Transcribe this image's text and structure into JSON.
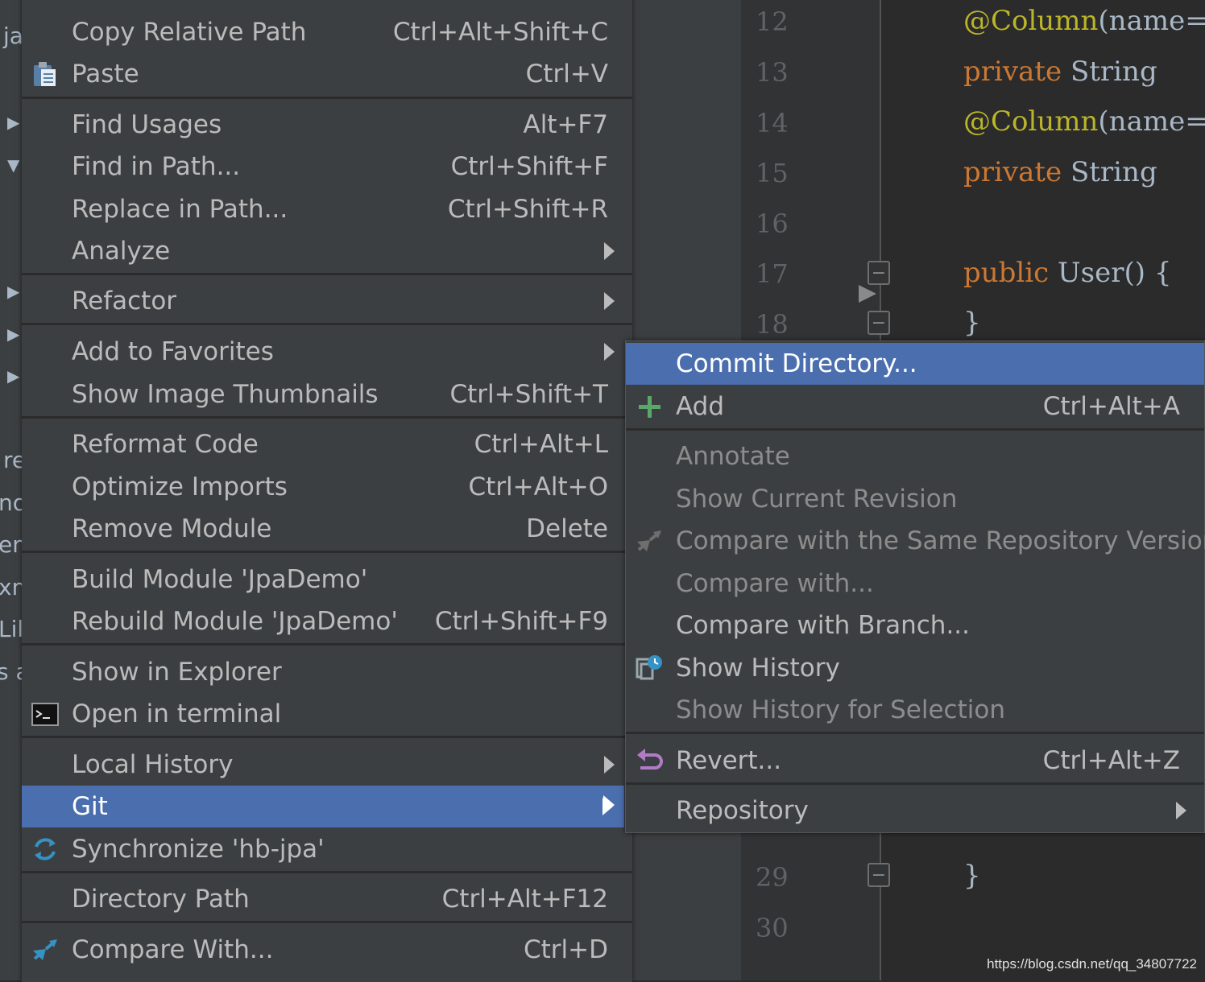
{
  "project": {
    "fragments": [
      "ja",
      "re",
      "no",
      "em",
      "xm",
      "Lil",
      "s a"
    ]
  },
  "editor": {
    "line_numbers": [
      "12",
      "13",
      "14",
      "15",
      "16",
      "17",
      "18",
      "29",
      "30"
    ],
    "code": {
      "l12_ann": "@Column",
      "l12_rest": "(name=\"u",
      "l13_kw": "private",
      "l13_rest": " String",
      "l14_ann": "@Column",
      "l14_rest": "(name=\"p",
      "l15_kw": "private",
      "l15_rest": " String",
      "l17_kw": "public",
      "l17_rest": " User() {",
      "l18": "}",
      "l29": "}"
    },
    "watermark": "https://blog.csdn.net/qq_34807722"
  },
  "context_menu": {
    "items": [
      {
        "label": "Copy Relative Path",
        "shortcut": "Ctrl+Alt+Shift+C"
      },
      {
        "label": "Paste",
        "shortcut": "Ctrl+V"
      },
      {
        "label": "Find Usages",
        "shortcut": "Alt+F7"
      },
      {
        "label": "Find in Path...",
        "shortcut": "Ctrl+Shift+F"
      },
      {
        "label": "Replace in Path...",
        "shortcut": "Ctrl+Shift+R"
      },
      {
        "label": "Analyze",
        "shortcut": ""
      },
      {
        "label": "Refactor",
        "shortcut": ""
      },
      {
        "label": "Add to Favorites",
        "shortcut": ""
      },
      {
        "label": "Show Image Thumbnails",
        "shortcut": "Ctrl+Shift+T"
      },
      {
        "label": "Reformat Code",
        "shortcut": "Ctrl+Alt+L"
      },
      {
        "label": "Optimize Imports",
        "shortcut": "Ctrl+Alt+O"
      },
      {
        "label": "Remove Module",
        "shortcut": "Delete"
      },
      {
        "label": "Build Module 'JpaDemo'",
        "shortcut": ""
      },
      {
        "label": "Rebuild Module 'JpaDemo'",
        "shortcut": "Ctrl+Shift+F9"
      },
      {
        "label": "Show in Explorer",
        "shortcut": ""
      },
      {
        "label": "Open in terminal",
        "shortcut": ""
      },
      {
        "label": "Local History",
        "shortcut": ""
      },
      {
        "label": "Git",
        "shortcut": ""
      },
      {
        "label": "Synchronize 'hb-jpa'",
        "shortcut": ""
      },
      {
        "label": "Directory Path",
        "shortcut": "Ctrl+Alt+F12"
      },
      {
        "label": "Compare With...",
        "shortcut": "Ctrl+D"
      }
    ]
  },
  "git_menu": {
    "items": [
      {
        "label": "Commit Directory...",
        "shortcut": ""
      },
      {
        "label": "Add",
        "shortcut": "Ctrl+Alt+A"
      },
      {
        "label": "Annotate",
        "shortcut": ""
      },
      {
        "label": "Show Current Revision",
        "shortcut": ""
      },
      {
        "label": "Compare with the Same Repository Version",
        "shortcut": ""
      },
      {
        "label": "Compare with...",
        "shortcut": ""
      },
      {
        "label": "Compare with Branch...",
        "shortcut": ""
      },
      {
        "label": "Show History",
        "shortcut": ""
      },
      {
        "label": "Show History for Selection",
        "shortcut": ""
      },
      {
        "label": "Revert...",
        "shortcut": "Ctrl+Alt+Z"
      },
      {
        "label": "Repository",
        "shortcut": ""
      }
    ]
  },
  "colors": {
    "menu_bg": "#3c3f41",
    "selection": "#4b6eaf",
    "editor_bg": "#2b2b2b",
    "annotation": "#bbb529",
    "keyword": "#cc7832"
  }
}
